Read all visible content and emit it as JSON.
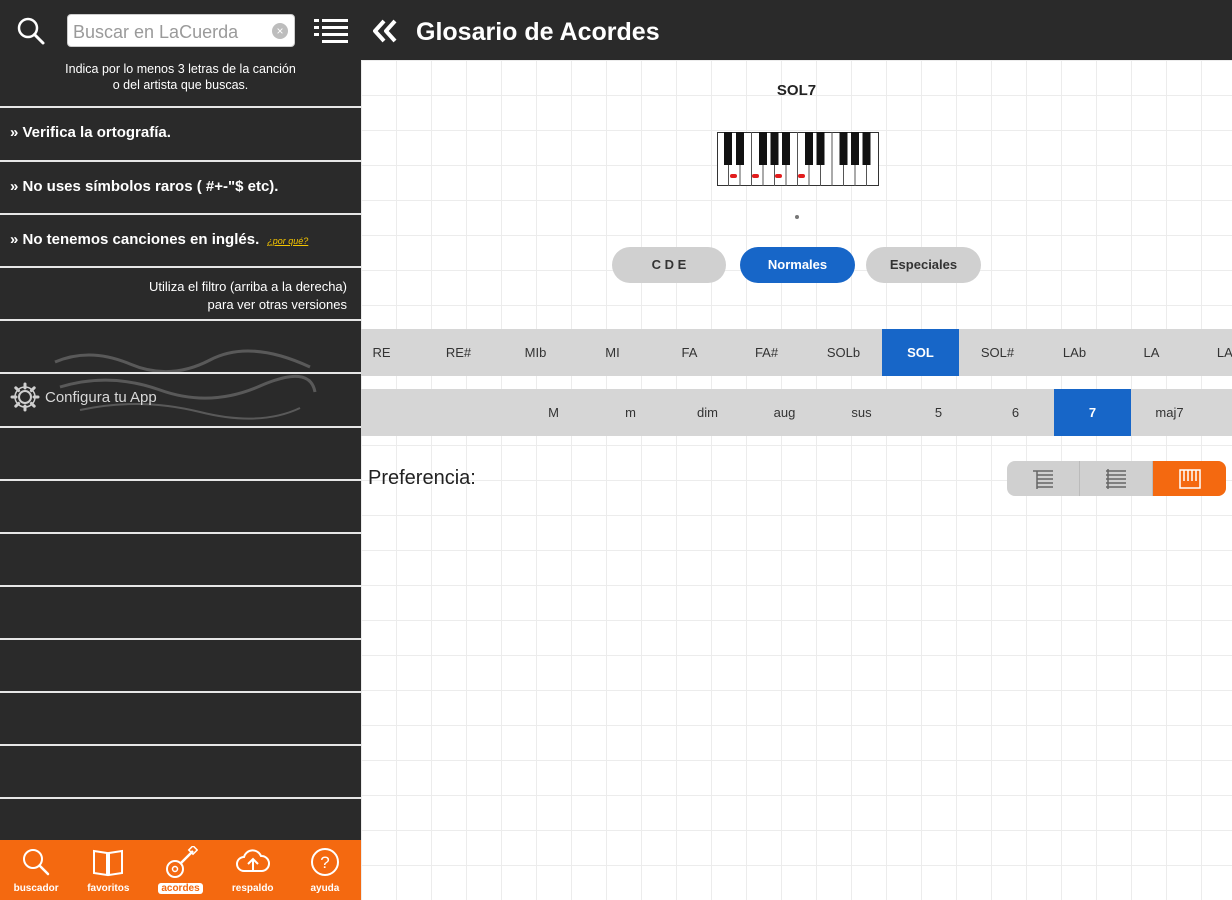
{
  "sidebar": {
    "search_placeholder": "Buscar en LaCuerda",
    "hint": "Indica por lo menos 3 letras de la canción o del artista que buscas.",
    "tips": [
      "» Verifica la ortografía.",
      "» No uses símbolos raros ( #+-\"$ etc).",
      "» No tenemos canciones en inglés."
    ],
    "why_link": "¿por qué?",
    "filter_note_line1": "Utiliza el filtro (arriba a la derecha)",
    "filter_note_line2": "para ver otras versiones",
    "config_label": "Configura tu App"
  },
  "tabbar": {
    "items": [
      {
        "label": "buscador",
        "icon": "search-icon"
      },
      {
        "label": "favoritos",
        "icon": "book-icon"
      },
      {
        "label": "acordes",
        "icon": "guitar-icon"
      },
      {
        "label": "respaldo",
        "icon": "cloud-upload-icon"
      },
      {
        "label": "ayuda",
        "icon": "help-icon"
      }
    ],
    "active": "acordes",
    "color": "#f46910"
  },
  "header": {
    "title": "Glosario de Acordes"
  },
  "chord": {
    "name": "SOL7"
  },
  "modes": {
    "items": [
      "C D E",
      "Normales",
      "Especiales"
    ],
    "active": "Normales"
  },
  "notes": {
    "items": [
      "RE",
      "RE#",
      "MIb",
      "MI",
      "FA",
      "FA#",
      "SOLb",
      "SOL",
      "SOL#",
      "LAb",
      "LA",
      "LA#"
    ],
    "active": "SOL"
  },
  "chord_types": {
    "items": [
      "M",
      "m",
      "dim",
      "aug",
      "sus",
      "5",
      "6",
      "7",
      "maj7"
    ],
    "active": "7"
  },
  "preference": {
    "label": "Preferencia:",
    "options": [
      "guitar-left-icon",
      "guitar-right-icon",
      "piano-icon"
    ],
    "active": "piano-icon"
  },
  "colors": {
    "accent_blue": "#1766c8",
    "accent_orange": "#f46910",
    "dark_bar": "#2a2a2a"
  }
}
